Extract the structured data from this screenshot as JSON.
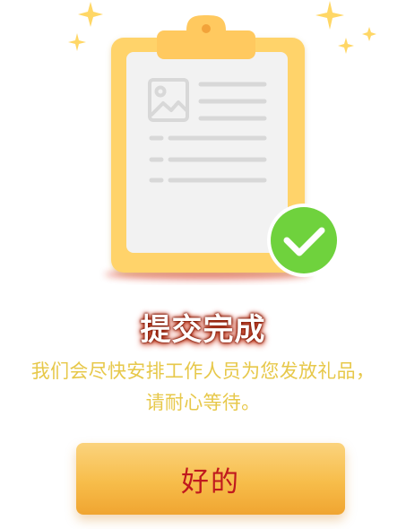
{
  "dialog": {
    "title": "提交完成",
    "message_line1": "我们会尽快安排工作人员为您发放礼品，",
    "message_line2": "请耐心等待。",
    "ok_button_label": "好的"
  },
  "colors": {
    "clipboard": "#ffd36b",
    "clip": "#ffc95f",
    "paper": "#f2f2f2",
    "check_badge": "#6fd23d",
    "sparkle": "#ffd766",
    "message_text": "#e7c84a",
    "button_text": "#c0191e",
    "title_glow": "#c11d00"
  },
  "icons": {
    "illustration": "clipboard-check-icon",
    "image_placeholder": "image-icon",
    "badge": "checkmark-icon",
    "decorations": "sparkle-icon"
  }
}
